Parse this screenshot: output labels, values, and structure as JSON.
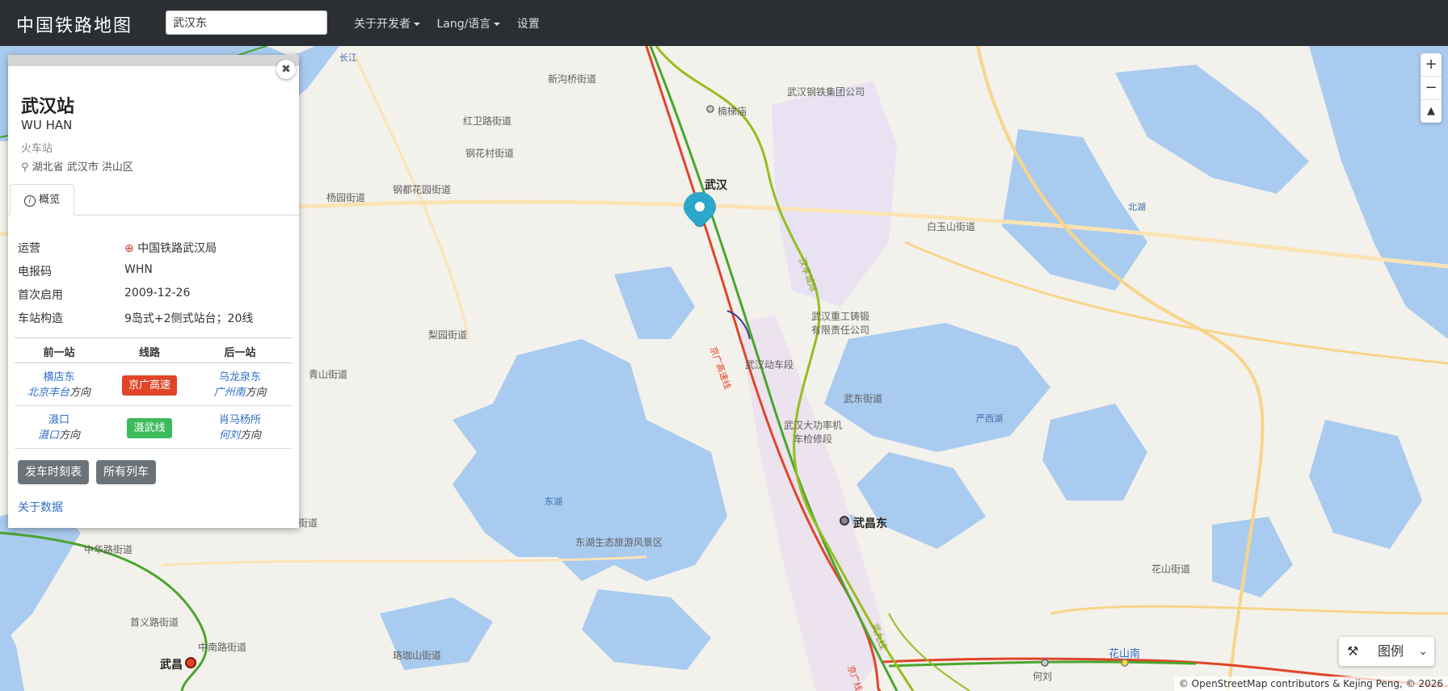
{
  "nav": {
    "brand": "中国铁路地图",
    "search_value": "武汉东",
    "links": [
      "关于开发者",
      "Lang/语言",
      "设置"
    ]
  },
  "map": {
    "labels": [
      "新沟桥街道",
      "红卫路街道",
      "钢花村街道",
      "杨园街道",
      "钢都花园街道",
      "青山街道",
      "武东街道",
      "白玉山街道",
      "梨园街道",
      "和平街道",
      "中华路街道",
      "首义路街道",
      "中南路街道",
      "珞珈山街道",
      "花山街道",
      "武汉钢铁集团公司",
      "武汉重工铸锻有限责任公司",
      "武汉动车段",
      "武汉大功率机车检修段",
      "东湖生态旅游风景区",
      "楠梯庙"
    ],
    "water": [
      "北湖",
      "严西湖",
      "东湖",
      "长江"
    ],
    "stations": [
      "武汉",
      "武昌东",
      "武昌",
      "花山南",
      "何刘"
    ],
    "line_labels": [
      "京广高速线",
      "汉孝城际",
      "武九线",
      "京广线"
    ],
    "colors": {
      "hsr": "#e0452a",
      "conventional": "#4aa52e",
      "lime": "#95be1d",
      "pin": "#2aa7c9"
    }
  },
  "panel": {
    "name": "武汉站",
    "name_en": "WU HAN",
    "type": "火车站",
    "location": "湖北省 武汉市 洪山区",
    "tab": "概览",
    "info": [
      {
        "label": "运营",
        "value": "中国铁路武汉局"
      },
      {
        "label": "电报码",
        "value": "WHN"
      },
      {
        "label": "首次启用",
        "value": "2009-12-26"
      },
      {
        "label": "车站构造",
        "value": "9岛式+2侧式站台；20线"
      }
    ],
    "adjacent": {
      "headers": [
        "前一站",
        "线路",
        "后一站"
      ],
      "rows": [
        {
          "prev": "横店东",
          "prev_dir": "北京丰台",
          "line": "京广高速",
          "line_color": "#e0452a",
          "next": "乌龙泉东",
          "next_dir": "广州南"
        },
        {
          "prev": "滠口",
          "prev_dir": "滠口",
          "line": "滠武线",
          "line_color": "#3cbb5b",
          "next": "肖马杨所",
          "next_dir": "何刘"
        }
      ],
      "dir_suffix": "方向"
    },
    "buttons": [
      "发车时刻表",
      "所有列车"
    ],
    "about": "关于数据"
  },
  "legend": {
    "label": "图例"
  },
  "attribution": "© OpenStreetMap contributors & Kejing Peng, © 2026"
}
